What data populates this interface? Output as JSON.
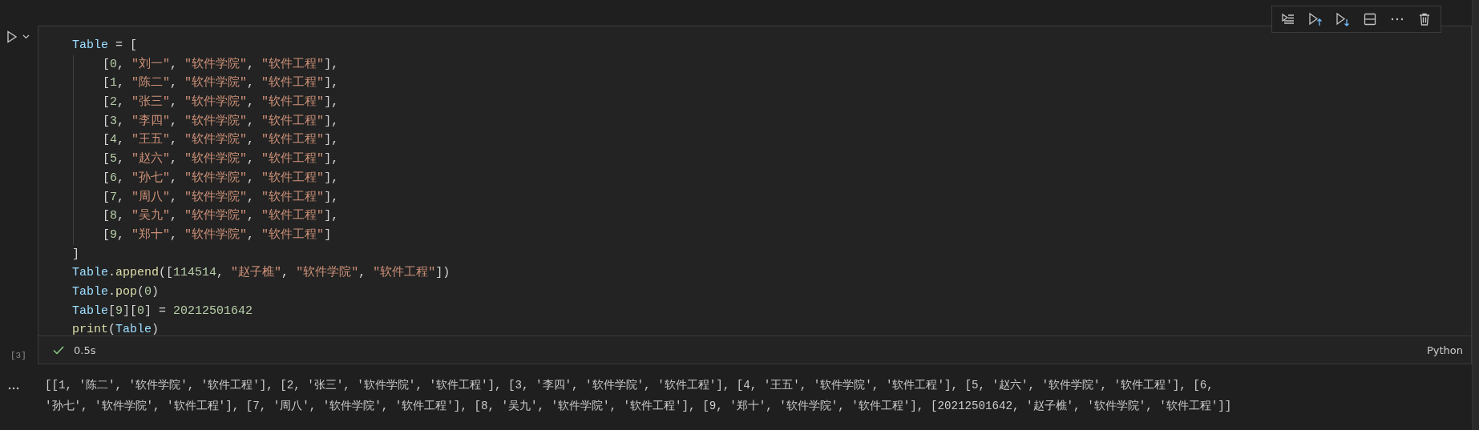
{
  "cell": {
    "execution_count": "[3]",
    "status": {
      "success": true,
      "duration": "0.5s"
    },
    "language": "Python",
    "code": [
      {
        "tokens": [
          {
            "kind": "name",
            "text": "Table"
          },
          {
            "kind": "punct",
            "text": " = ["
          }
        ],
        "children": [
          {
            "tokens": [
              {
                "kind": "punct",
                "text": "["
              },
              {
                "kind": "num",
                "text": "0"
              },
              {
                "kind": "punct",
                "text": ", "
              },
              {
                "kind": "str",
                "text": "\"刘一\""
              },
              {
                "kind": "punct",
                "text": ", "
              },
              {
                "kind": "str",
                "text": "\"软件学院\""
              },
              {
                "kind": "punct",
                "text": ", "
              },
              {
                "kind": "str",
                "text": "\"软件工程\""
              },
              {
                "kind": "punct",
                "text": "],"
              }
            ]
          },
          {
            "tokens": [
              {
                "kind": "punct",
                "text": "["
              },
              {
                "kind": "num",
                "text": "1"
              },
              {
                "kind": "punct",
                "text": ", "
              },
              {
                "kind": "str",
                "text": "\"陈二\""
              },
              {
                "kind": "punct",
                "text": ", "
              },
              {
                "kind": "str",
                "text": "\"软件学院\""
              },
              {
                "kind": "punct",
                "text": ", "
              },
              {
                "kind": "str",
                "text": "\"软件工程\""
              },
              {
                "kind": "punct",
                "text": "],"
              }
            ]
          },
          {
            "tokens": [
              {
                "kind": "punct",
                "text": "["
              },
              {
                "kind": "num",
                "text": "2"
              },
              {
                "kind": "punct",
                "text": ", "
              },
              {
                "kind": "str",
                "text": "\"张三\""
              },
              {
                "kind": "punct",
                "text": ", "
              },
              {
                "kind": "str",
                "text": "\"软件学院\""
              },
              {
                "kind": "punct",
                "text": ", "
              },
              {
                "kind": "str",
                "text": "\"软件工程\""
              },
              {
                "kind": "punct",
                "text": "],"
              }
            ]
          },
          {
            "tokens": [
              {
                "kind": "punct",
                "text": "["
              },
              {
                "kind": "num",
                "text": "3"
              },
              {
                "kind": "punct",
                "text": ", "
              },
              {
                "kind": "str",
                "text": "\"李四\""
              },
              {
                "kind": "punct",
                "text": ", "
              },
              {
                "kind": "str",
                "text": "\"软件学院\""
              },
              {
                "kind": "punct",
                "text": ", "
              },
              {
                "kind": "str",
                "text": "\"软件工程\""
              },
              {
                "kind": "punct",
                "text": "],"
              }
            ]
          },
          {
            "tokens": [
              {
                "kind": "punct",
                "text": "["
              },
              {
                "kind": "num",
                "text": "4"
              },
              {
                "kind": "punct",
                "text": ", "
              },
              {
                "kind": "str",
                "text": "\"王五\""
              },
              {
                "kind": "punct",
                "text": ", "
              },
              {
                "kind": "str",
                "text": "\"软件学院\""
              },
              {
                "kind": "punct",
                "text": ", "
              },
              {
                "kind": "str",
                "text": "\"软件工程\""
              },
              {
                "kind": "punct",
                "text": "],"
              }
            ]
          },
          {
            "tokens": [
              {
                "kind": "punct",
                "text": "["
              },
              {
                "kind": "num",
                "text": "5"
              },
              {
                "kind": "punct",
                "text": ", "
              },
              {
                "kind": "str",
                "text": "\"赵六\""
              },
              {
                "kind": "punct",
                "text": ", "
              },
              {
                "kind": "str",
                "text": "\"软件学院\""
              },
              {
                "kind": "punct",
                "text": ", "
              },
              {
                "kind": "str",
                "text": "\"软件工程\""
              },
              {
                "kind": "punct",
                "text": "],"
              }
            ]
          },
          {
            "tokens": [
              {
                "kind": "punct",
                "text": "["
              },
              {
                "kind": "num",
                "text": "6"
              },
              {
                "kind": "punct",
                "text": ", "
              },
              {
                "kind": "str",
                "text": "\"孙七\""
              },
              {
                "kind": "punct",
                "text": ", "
              },
              {
                "kind": "str",
                "text": "\"软件学院\""
              },
              {
                "kind": "punct",
                "text": ", "
              },
              {
                "kind": "str",
                "text": "\"软件工程\""
              },
              {
                "kind": "punct",
                "text": "],"
              }
            ]
          },
          {
            "tokens": [
              {
                "kind": "punct",
                "text": "["
              },
              {
                "kind": "num",
                "text": "7"
              },
              {
                "kind": "punct",
                "text": ", "
              },
              {
                "kind": "str",
                "text": "\"周八\""
              },
              {
                "kind": "punct",
                "text": ", "
              },
              {
                "kind": "str",
                "text": "\"软件学院\""
              },
              {
                "kind": "punct",
                "text": ", "
              },
              {
                "kind": "str",
                "text": "\"软件工程\""
              },
              {
                "kind": "punct",
                "text": "],"
              }
            ]
          },
          {
            "tokens": [
              {
                "kind": "punct",
                "text": "["
              },
              {
                "kind": "num",
                "text": "8"
              },
              {
                "kind": "punct",
                "text": ", "
              },
              {
                "kind": "str",
                "text": "\"吴九\""
              },
              {
                "kind": "punct",
                "text": ", "
              },
              {
                "kind": "str",
                "text": "\"软件学院\""
              },
              {
                "kind": "punct",
                "text": ", "
              },
              {
                "kind": "str",
                "text": "\"软件工程\""
              },
              {
                "kind": "punct",
                "text": "],"
              }
            ]
          },
          {
            "tokens": [
              {
                "kind": "punct",
                "text": "["
              },
              {
                "kind": "num",
                "text": "9"
              },
              {
                "kind": "punct",
                "text": ", "
              },
              {
                "kind": "str",
                "text": "\"郑十\""
              },
              {
                "kind": "punct",
                "text": ", "
              },
              {
                "kind": "str",
                "text": "\"软件学院\""
              },
              {
                "kind": "punct",
                "text": ", "
              },
              {
                "kind": "str",
                "text": "\"软件工程\""
              },
              {
                "kind": "punct",
                "text": "]"
              }
            ]
          }
        ]
      },
      {
        "tokens": [
          {
            "kind": "punct",
            "text": "]"
          }
        ]
      },
      {
        "tokens": [
          {
            "kind": "name",
            "text": "Table"
          },
          {
            "kind": "punct",
            "text": "."
          },
          {
            "kind": "func",
            "text": "append"
          },
          {
            "kind": "punct",
            "text": "(["
          },
          {
            "kind": "num",
            "text": "114514"
          },
          {
            "kind": "punct",
            "text": ", "
          },
          {
            "kind": "str",
            "text": "\"赵子樵\""
          },
          {
            "kind": "punct",
            "text": ", "
          },
          {
            "kind": "str",
            "text": "\"软件学院\""
          },
          {
            "kind": "punct",
            "text": ", "
          },
          {
            "kind": "str",
            "text": "\"软件工程\""
          },
          {
            "kind": "punct",
            "text": "])"
          }
        ]
      },
      {
        "tokens": [
          {
            "kind": "name",
            "text": "Table"
          },
          {
            "kind": "punct",
            "text": "."
          },
          {
            "kind": "func",
            "text": "pop"
          },
          {
            "kind": "punct",
            "text": "("
          },
          {
            "kind": "num",
            "text": "0"
          },
          {
            "kind": "punct",
            "text": ")"
          }
        ]
      },
      {
        "tokens": [
          {
            "kind": "name",
            "text": "Table"
          },
          {
            "kind": "punct",
            "text": "["
          },
          {
            "kind": "num",
            "text": "9"
          },
          {
            "kind": "punct",
            "text": "]["
          },
          {
            "kind": "num",
            "text": "0"
          },
          {
            "kind": "punct",
            "text": "] = "
          },
          {
            "kind": "num",
            "text": "20212501642"
          }
        ]
      },
      {
        "tokens": [
          {
            "kind": "func",
            "text": "print"
          },
          {
            "kind": "punct",
            "text": "("
          },
          {
            "kind": "name",
            "text": "Table"
          },
          {
            "kind": "punct",
            "text": ")"
          }
        ]
      }
    ]
  },
  "output": {
    "lines": [
      "[[1, '陈二', '软件学院', '软件工程'], [2, '张三', '软件学院', '软件工程'], [3, '李四', '软件学院', '软件工程'], [4, '王五', '软件学院', '软件工程'], [5, '赵六', '软件学院', '软件工程'], [6,",
      "'孙七', '软件学院', '软件工程'], [7, '周八', '软件学院', '软件工程'], [8, '吴九', '软件学院', '软件工程'], [9, '郑十', '软件学院', '软件工程'], [20212501642, '赵子樵', '软件学院', '软件工程']]"
    ]
  }
}
